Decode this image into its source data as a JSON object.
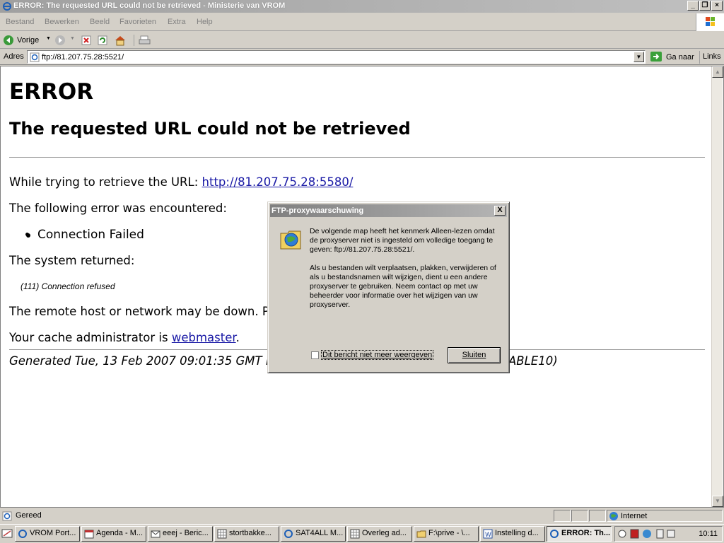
{
  "window": {
    "title": "ERROR: The requested URL could not be retrieved - Ministerie van VROM"
  },
  "menu": [
    "Bestand",
    "Bewerken",
    "Beeld",
    "Favorieten",
    "Extra",
    "Help"
  ],
  "toolbar": {
    "back_label": "Vorige"
  },
  "address": {
    "label": "Adres",
    "value": "ftp://81.207.75.28:5521/",
    "go_label": "Ga naar",
    "links_label": "Links"
  },
  "page": {
    "h1": "ERROR",
    "h2": "The requested URL could not be retrieved",
    "retrieve_prefix": "While trying to retrieve the URL: ",
    "retrieve_url": "http://81.207.75.28:5580/",
    "error_intro": "The following error was encountered:",
    "error_item": "Connection Failed",
    "system_returned": "The system returned:",
    "system_message": "(111) Connection refused",
    "remote_host": "The remote host or network may be down. P",
    "cache_prefix": "Your cache administrator is ",
    "cache_link": "webmaster",
    "cache_suffix": ".",
    "generated_left": "Generated Tue, 13 Feb 2007 09:01:35 GMT b",
    "generated_right": "ABLE10)"
  },
  "dialog": {
    "title": "FTP-proxywaarschuwing",
    "close_label": "X",
    "message_1": "De volgende map heeft het kenmerk Alleen-lezen omdat de proxyserver niet is ingesteld om volledige toegang te geven: ftp://81.207.75.28:5521/.",
    "message_2": "Als u bestanden wilt verplaatsen, plakken, verwijderen of als u bestandsnamen wilt wijzigen, dient u een andere proxyserver te gebruiken. Neem contact op met uw beheerder voor informatie over het wijzigen van uw proxyserver.",
    "checkbox_label": "Dit bericht niet meer weergeven",
    "button_label": "Sluiten"
  },
  "status": {
    "text": "Gereed",
    "zone": "Internet"
  },
  "taskbar": {
    "tasks": [
      "VROM Port...",
      "Agenda - M...",
      "eeej - Beric...",
      "stortbakke...",
      "SAT4ALL M...",
      "Overleg ad...",
      "F:\\prive - \\...",
      "Instelling d...",
      "ERROR: Th..."
    ],
    "clock": "10:11"
  },
  "colors": {
    "link": "#1a1aa6",
    "titlebar_inactive": "#a0a0a0"
  }
}
